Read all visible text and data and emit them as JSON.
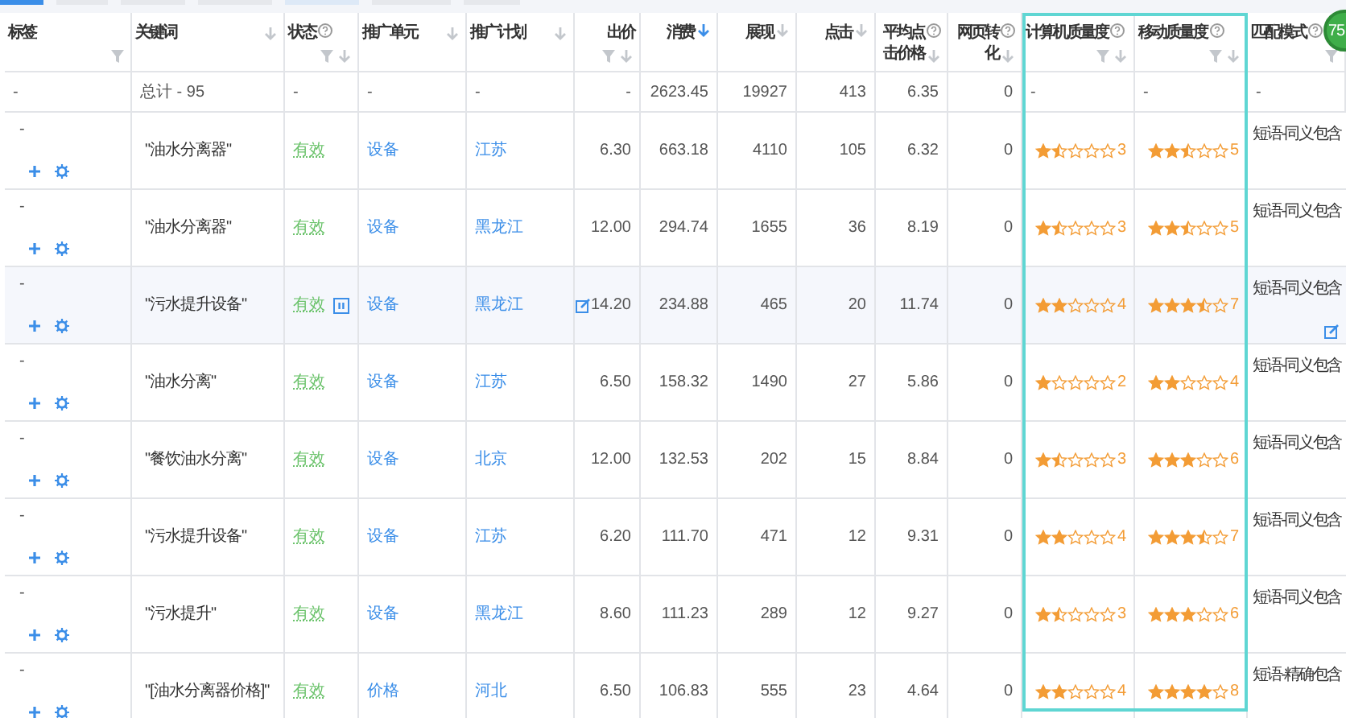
{
  "badge": {
    "text": "75"
  },
  "columns": [
    {
      "label": "标签",
      "help": false,
      "filter": true,
      "sort": false
    },
    {
      "label": "关键词",
      "help": false,
      "filter": false,
      "sort": true,
      "sort_active": false
    },
    {
      "label": "状态",
      "help": true,
      "filter": true,
      "sort": true,
      "sort_active": false
    },
    {
      "label": "推广单元",
      "help": false,
      "filter": false,
      "sort": true,
      "sort_active": false
    },
    {
      "label": "推广计划",
      "help": false,
      "filter": false,
      "sort": true,
      "sort_active": false
    },
    {
      "label": "出价",
      "help": false,
      "filter": true,
      "sort": true,
      "sort_active": false
    },
    {
      "label": "消费",
      "help": false,
      "filter": false,
      "sort": true,
      "sort_active": true
    },
    {
      "label": "展现",
      "help": false,
      "filter": false,
      "sort": true,
      "sort_active": false
    },
    {
      "label": "点击",
      "help": false,
      "filter": false,
      "sort": true,
      "sort_active": false
    },
    {
      "label": "平均点击价格",
      "help": true,
      "filter": false,
      "sort": true,
      "sort_active": false
    },
    {
      "label": "网页转化",
      "help": true,
      "filter": false,
      "sort": true,
      "sort_active": false
    },
    {
      "label": "计算机质量度",
      "help": true,
      "filter": true,
      "sort": true,
      "sort_active": false
    },
    {
      "label": "移动质量度",
      "help": true,
      "filter": true,
      "sort": true,
      "sort_active": false
    },
    {
      "label": "匹配模式",
      "help": true,
      "filter": true,
      "sort": false
    }
  ],
  "total_row": [
    "-",
    "总计 - 95",
    "-",
    "-",
    "-",
    "-",
    "2623.45",
    "19927",
    "413",
    "6.35",
    "0",
    "-",
    "-",
    "-"
  ],
  "rows": [
    {
      "tag": "-",
      "keyword": "\"油水分离器\"",
      "status": "有效",
      "unit": "设备",
      "plan": "江苏",
      "bid": "6.30",
      "cost": "663.18",
      "impressions": "4110",
      "clicks": "105",
      "avg_cpc": "6.32",
      "conversions": "0",
      "pc_quality": {
        "stars": 1.5,
        "score": "3"
      },
      "mobile_quality": {
        "stars": 2.5,
        "score": "5"
      },
      "match": "短语-同义包含",
      "highlighted": false
    },
    {
      "tag": "-",
      "keyword": "\"油水分离器\"",
      "status": "有效",
      "unit": "设备",
      "plan": "黑龙江",
      "bid": "12.00",
      "cost": "294.74",
      "impressions": "1655",
      "clicks": "36",
      "avg_cpc": "8.19",
      "conversions": "0",
      "pc_quality": {
        "stars": 1.5,
        "score": "3"
      },
      "mobile_quality": {
        "stars": 2.5,
        "score": "5"
      },
      "match": "短语-同义包含",
      "highlighted": false
    },
    {
      "tag": "-",
      "keyword": "\"污水提升设备\"",
      "status": "有效",
      "unit": "设备",
      "plan": "黑龙江",
      "bid": "14.20",
      "cost": "234.88",
      "impressions": "465",
      "clicks": "20",
      "avg_cpc": "11.74",
      "conversions": "0",
      "pc_quality": {
        "stars": 2,
        "score": "4"
      },
      "mobile_quality": {
        "stars": 3.5,
        "score": "7"
      },
      "match": "短语-同义包含",
      "highlighted": true
    },
    {
      "tag": "-",
      "keyword": "\"油水分离\"",
      "status": "有效",
      "unit": "设备",
      "plan": "江苏",
      "bid": "6.50",
      "cost": "158.32",
      "impressions": "1490",
      "clicks": "27",
      "avg_cpc": "5.86",
      "conversions": "0",
      "pc_quality": {
        "stars": 1,
        "score": "2"
      },
      "mobile_quality": {
        "stars": 2,
        "score": "4"
      },
      "match": "短语-同义包含",
      "highlighted": false
    },
    {
      "tag": "-",
      "keyword": "\"餐饮油水分离\"",
      "status": "有效",
      "unit": "设备",
      "plan": "北京",
      "bid": "12.00",
      "cost": "132.53",
      "impressions": "202",
      "clicks": "15",
      "avg_cpc": "8.84",
      "conversions": "0",
      "pc_quality": {
        "stars": 1.5,
        "score": "3"
      },
      "mobile_quality": {
        "stars": 3,
        "score": "6"
      },
      "match": "短语-同义包含",
      "highlighted": false
    },
    {
      "tag": "-",
      "keyword": "\"污水提升设备\"",
      "status": "有效",
      "unit": "设备",
      "plan": "江苏",
      "bid": "6.20",
      "cost": "111.70",
      "impressions": "471",
      "clicks": "12",
      "avg_cpc": "9.31",
      "conversions": "0",
      "pc_quality": {
        "stars": 2,
        "score": "4"
      },
      "mobile_quality": {
        "stars": 3.5,
        "score": "7"
      },
      "match": "短语-同义包含",
      "highlighted": false
    },
    {
      "tag": "-",
      "keyword": "\"污水提升\"",
      "status": "有效",
      "unit": "设备",
      "plan": "黑龙江",
      "bid": "8.60",
      "cost": "111.23",
      "impressions": "289",
      "clicks": "12",
      "avg_cpc": "9.27",
      "conversions": "0",
      "pc_quality": {
        "stars": 1.5,
        "score": "3"
      },
      "mobile_quality": {
        "stars": 3,
        "score": "6"
      },
      "match": "短语-同义包含",
      "highlighted": false
    },
    {
      "tag": "-",
      "keyword": "\"[油水分离器价格]\"",
      "status": "有效",
      "unit": "价格",
      "plan": "河北",
      "bid": "6.50",
      "cost": "106.83",
      "impressions": "555",
      "clicks": "23",
      "avg_cpc": "4.64",
      "conversions": "0",
      "pc_quality": {
        "stars": 2,
        "score": "4"
      },
      "mobile_quality": {
        "stars": 4,
        "score": "8"
      },
      "match": "短语-精确包含",
      "highlighted": false
    }
  ]
}
